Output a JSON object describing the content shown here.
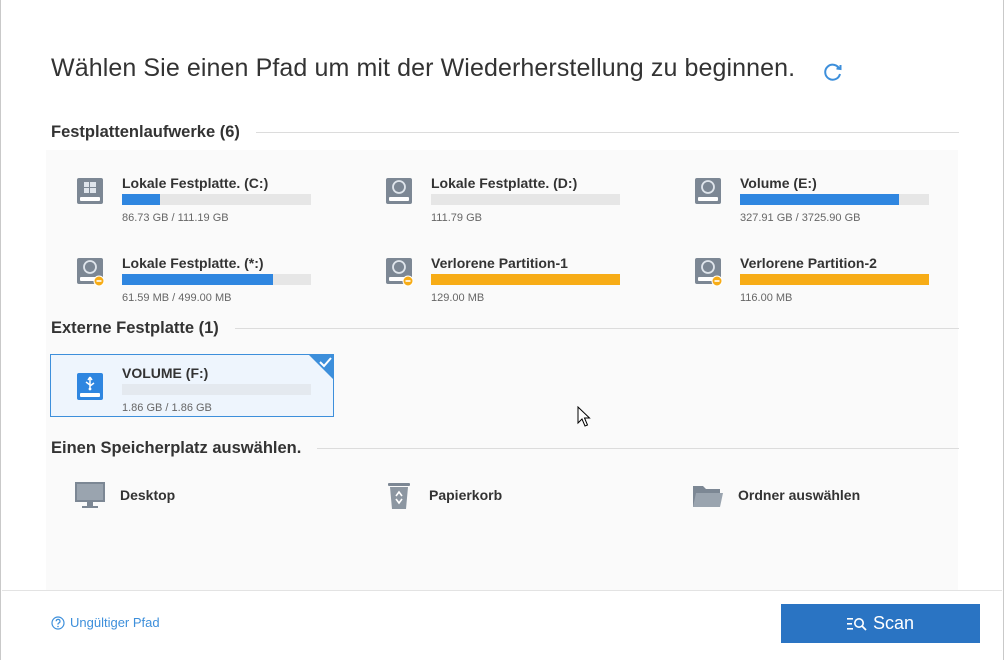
{
  "title": "Wählen Sie einen Pfad um mit der Wiederherstellung zu beginnen.",
  "colors": {
    "blue_bar": "#2f86e0",
    "orange_bar": "#f7ac16",
    "accent": "#3d8fdb",
    "scan_button": "#2a74c3"
  },
  "sections": {
    "hard_drives": "Festplattenlaufwerke (6)",
    "external": "Externe Festplatte (1)",
    "locations": "Einen Speicherplatz auswählen."
  },
  "drives": [
    {
      "name": "Lokale Festplatte. (C:)",
      "size": "86.73 GB / 111.19 GB",
      "fill_fraction": 0.2,
      "color": "blue",
      "icon": "windows-drive-icon"
    },
    {
      "name": "Lokale Festplatte. (D:)",
      "size": "111.79 GB",
      "fill_fraction": 0,
      "color": "blue",
      "icon": "hard-drive-icon"
    },
    {
      "name": "Volume (E:)",
      "size": "327.91 GB / 3725.90 GB",
      "fill_fraction": 0.84,
      "color": "blue",
      "icon": "hard-drive-icon"
    },
    {
      "name": "Lokale Festplatte. (*:)",
      "size": "61.59 MB / 499.00 MB",
      "fill_fraction": 0.8,
      "color": "blue",
      "icon": "hard-drive-warning-icon"
    },
    {
      "name": "Verlorene Partition-1",
      "size": "129.00 MB",
      "fill_fraction": 1.0,
      "color": "orange",
      "icon": "hard-drive-warning-icon"
    },
    {
      "name": "Verlorene Partition-2",
      "size": "116.00 MB",
      "fill_fraction": 1.0,
      "color": "orange",
      "icon": "hard-drive-warning-icon"
    }
  ],
  "external_drive": {
    "name": "VOLUME (F:)",
    "size": "1.86 GB / 1.86 GB",
    "fill_fraction": 0,
    "icon": "usb-drive-icon",
    "selected": true
  },
  "locations": [
    {
      "label": "Desktop",
      "icon": "monitor-icon"
    },
    {
      "label": "Papierkorb",
      "icon": "recycle-bin-icon"
    },
    {
      "label": "Ordner auswählen",
      "icon": "folder-icon"
    }
  ],
  "footer": {
    "help_link": "Ungültiger Pfad",
    "scan_label": "Scan"
  }
}
